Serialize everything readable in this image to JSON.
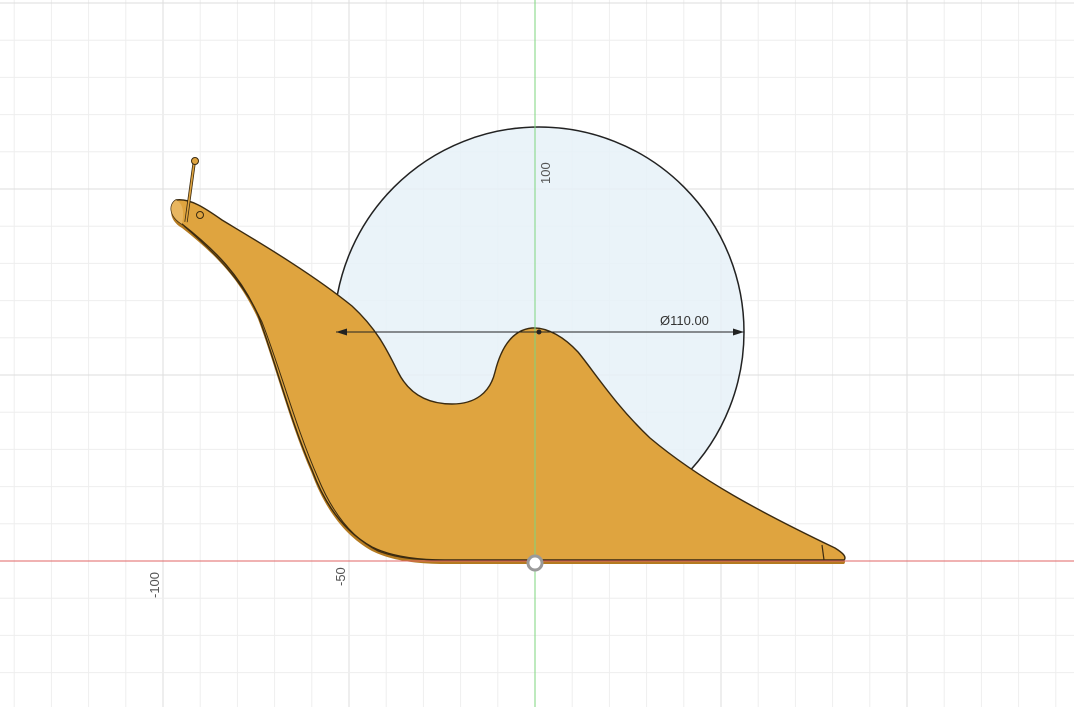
{
  "viewport": {
    "axis_labels": {
      "x_neg_100": "-100",
      "x_neg_50": "-50",
      "y_100": "100"
    },
    "dimension": {
      "diameter_label": "Ø110.00"
    }
  },
  "colors": {
    "background": "#ffffff",
    "grid_minor": "#eeeeee",
    "grid_major": "#dddddd",
    "x_axis": "#e06666",
    "y_axis": "#7ed67e",
    "body_fill": "#dfa43f",
    "body_edge": "#3a2a10",
    "circle_fill": "#e6f1f8",
    "circle_stroke": "#222222",
    "origin_marker": "#9a9a9a"
  }
}
